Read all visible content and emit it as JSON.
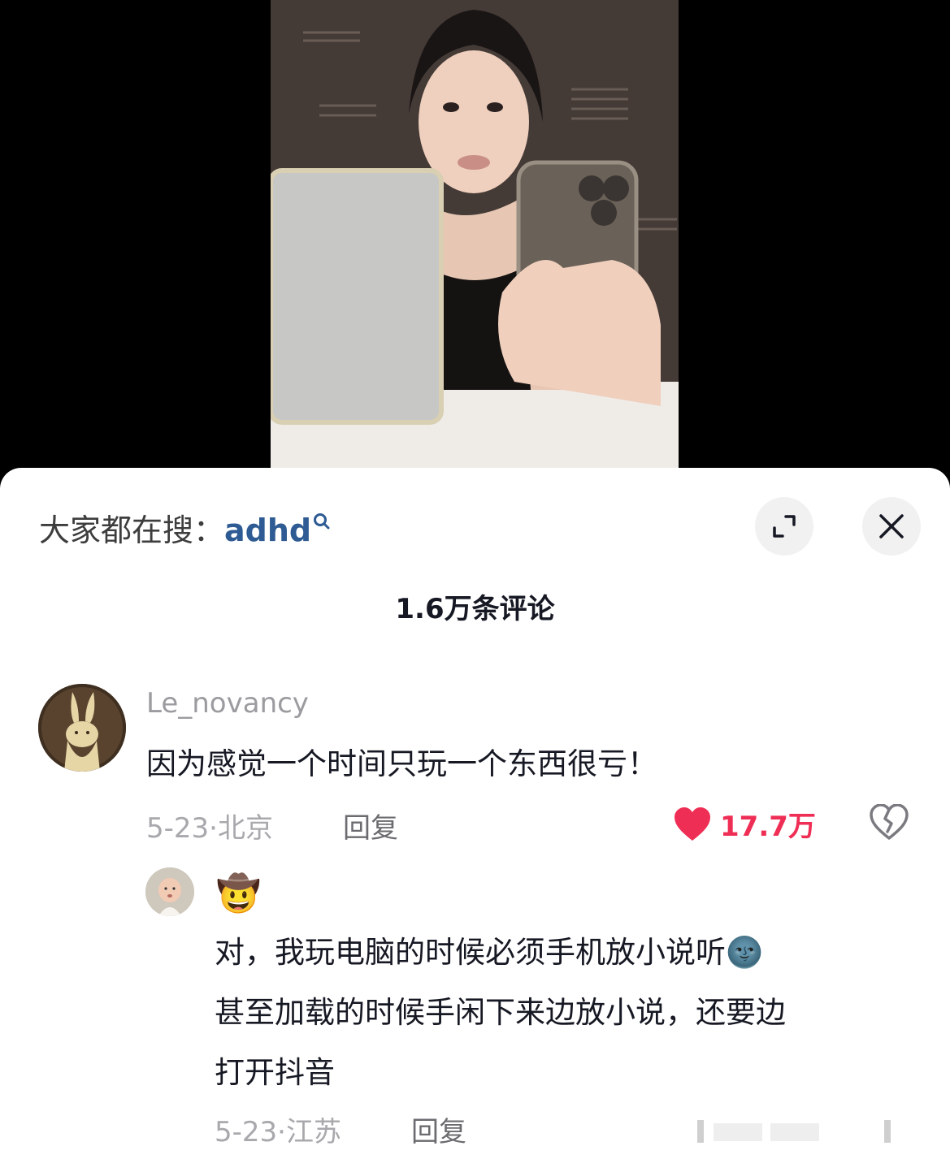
{
  "search": {
    "prefix": "大家都在搜：",
    "keyword": "adhd"
  },
  "header": {
    "comment_count": "1.6万条评论"
  },
  "comments": [
    {
      "username": "Le_novancy",
      "text": "因为感觉一个时间只玩一个东西很亏！",
      "date": "5-23",
      "location": "北京",
      "reply_label": "回复",
      "likes": "17.7万",
      "liked": true
    }
  ],
  "replies": [
    {
      "username_emoji": "🤠",
      "text_lines": [
        "对，我玩电脑的时候必须手机放小说听🌚",
        "甚至加载的时候手闲下来边放小说，还要边",
        "打开抖音"
      ],
      "date": "5-23",
      "location": "江苏",
      "reply_label": "回复"
    }
  ],
  "colors": {
    "like": "#ef2e55",
    "keyword": "#2e5b93",
    "muted": "#a8a8ad"
  },
  "icons": [
    "search-icon",
    "expand-icon",
    "close-icon",
    "heart-icon",
    "broken-heart-icon"
  ]
}
